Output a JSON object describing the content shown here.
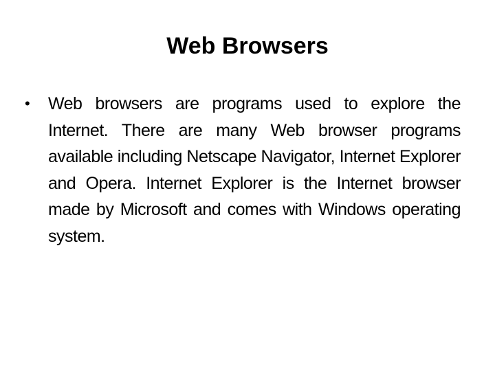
{
  "slide": {
    "title": "Web Browsers",
    "bullets": [
      {
        "marker": "•",
        "text": "Web browsers are programs used to explore the Internet. There are many Web browser programs available including Netscape Navigator, Internet Explorer and Opera. Internet Explorer is the Internet browser made by Microsoft and comes with Windows operating system."
      }
    ]
  }
}
